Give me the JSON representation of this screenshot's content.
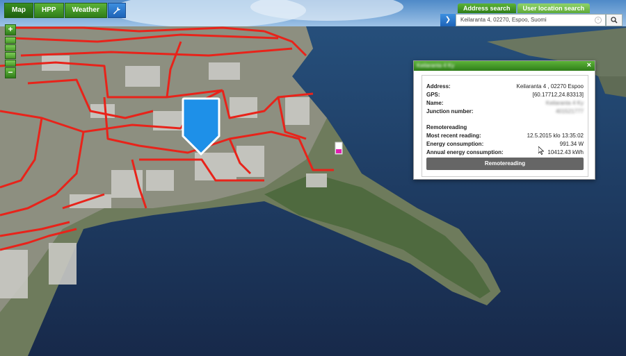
{
  "top_nav": {
    "tabs": [
      {
        "label": "Map"
      },
      {
        "label": "HPP"
      },
      {
        "label": "Weather"
      }
    ],
    "tool_icon": "wrench-icon"
  },
  "zoom": {
    "in": "+",
    "out": "−"
  },
  "search": {
    "tabs": [
      "Address search",
      "User location search"
    ],
    "value": "Keilaranta 4, 02270, Espoo, Suomi",
    "go_icon": "chevron-right-icon",
    "clear_icon": "clear-icon",
    "search_icon": "magnifier-icon"
  },
  "popup": {
    "title": "Keilaranta 4 Ky",
    "close": "×",
    "fields": [
      {
        "label": "Address:",
        "value": "Keilaranta 4 , 02270 Espoo",
        "blurred": false
      },
      {
        "label": "GPS:",
        "value": "[60.17712,24.83313]",
        "blurred": false
      },
      {
        "label": "Name:",
        "value": "Keilaranta 4 Ky",
        "blurred": true
      },
      {
        "label": "Junction number:",
        "value": "401521777",
        "blurred": true
      }
    ],
    "section": "Remotereading",
    "readings": [
      {
        "label": "Most recent reading:",
        "value": "12.5.2015 klo 13:35:02"
      },
      {
        "label": "Energy consumption:",
        "value": "991.34 W"
      },
      {
        "label": "Annual energy consumption:",
        "value": "10412.43 kWh"
      }
    ],
    "button": "Remotereading"
  },
  "colors": {
    "green": "#3a8f22",
    "blue": "#1e90e8",
    "network_red": "#e8231a",
    "water": "#1b3358"
  }
}
